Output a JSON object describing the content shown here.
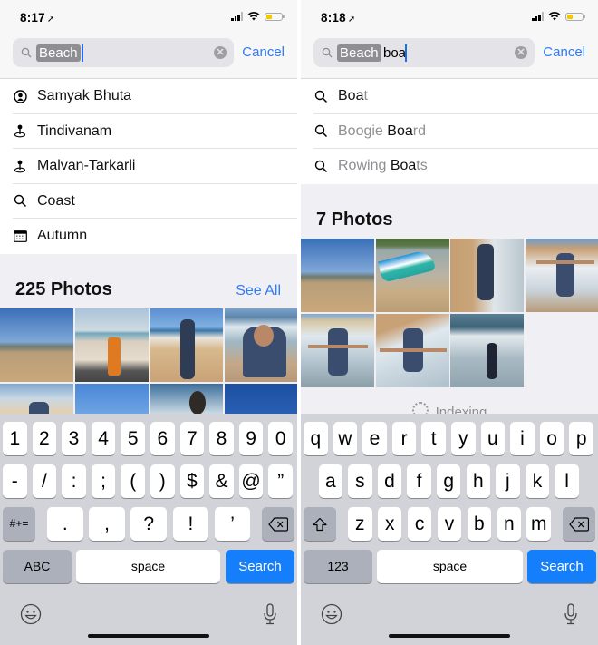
{
  "left": {
    "status": {
      "time": "8:17",
      "location_icon": "location-arrow-icon",
      "battery_level_pct": 25
    },
    "search": {
      "token": "Beach",
      "typed": "",
      "cancel_label": "Cancel"
    },
    "suggestions": [
      {
        "icon": "person-icon",
        "label": "Samyak Bhuta"
      },
      {
        "icon": "location-pin-icon",
        "label": "Tindivanam"
      },
      {
        "icon": "location-pin-icon",
        "label": "Malvan-Tarkarli"
      },
      {
        "icon": "search-icon",
        "label": "Coast"
      },
      {
        "icon": "calendar-icon",
        "label": "Autumn"
      }
    ],
    "results": {
      "title": "225 Photos",
      "see_all_label": "See All",
      "photos": [
        "beach-boats",
        "strong-beer-can",
        "man-standing-beach",
        "man-shouting-waves",
        "man-arms-out-beach",
        "man-head-sea",
        "man-in-waves",
        "blue-sky"
      ]
    },
    "keyboard": {
      "mode": "numbers",
      "row1": [
        "1",
        "2",
        "3",
        "4",
        "5",
        "6",
        "7",
        "8",
        "9",
        "0"
      ],
      "row2": [
        "-",
        "/",
        ":",
        ";",
        "(",
        ")",
        "$",
        "&",
        "@",
        "”"
      ],
      "row3": [
        ".",
        ",",
        "?",
        "!",
        "’"
      ],
      "shift_label": "#+=",
      "mode_label": "ABC",
      "space_label": "space",
      "return_label": "Search"
    }
  },
  "right": {
    "status": {
      "time": "8:18",
      "location_icon": "location-arrow-icon",
      "battery_level_pct": 25
    },
    "search": {
      "token": "Beach",
      "typed": "boa",
      "cancel_label": "Cancel"
    },
    "suggestions": [
      {
        "icon": "search-icon",
        "pre": "",
        "match": "Boa",
        "post": "t"
      },
      {
        "icon": "search-icon",
        "pre": "Boogie ",
        "match": "Boa",
        "post": "rd"
      },
      {
        "icon": "search-icon",
        "pre": "Rowing ",
        "match": "Boa",
        "post": "ts"
      }
    ],
    "results": {
      "title": "7 Photos",
      "photos": [
        "beach-boats",
        "blue-boat-sand",
        "man-walking-waves",
        "man-arms-out-waves",
        "man-arms-out-surf",
        "man-splash-waves",
        "man-back-sea"
      ]
    },
    "indexing_label": "Indexing",
    "keyboard": {
      "mode": "letters",
      "row1": [
        "q",
        "w",
        "e",
        "r",
        "t",
        "y",
        "u",
        "i",
        "o",
        "p"
      ],
      "row2": [
        "a",
        "s",
        "d",
        "f",
        "g",
        "h",
        "j",
        "k",
        "l"
      ],
      "row3": [
        "z",
        "x",
        "c",
        "v",
        "b",
        "n",
        "m"
      ],
      "mode_label": "123",
      "space_label": "space",
      "return_label": "Search"
    }
  },
  "colors": {
    "accent": "#2f7bf5",
    "search_key": "#157efb",
    "keyboard_bg": "#d1d3d9",
    "token_bg": "#8e8e93"
  }
}
